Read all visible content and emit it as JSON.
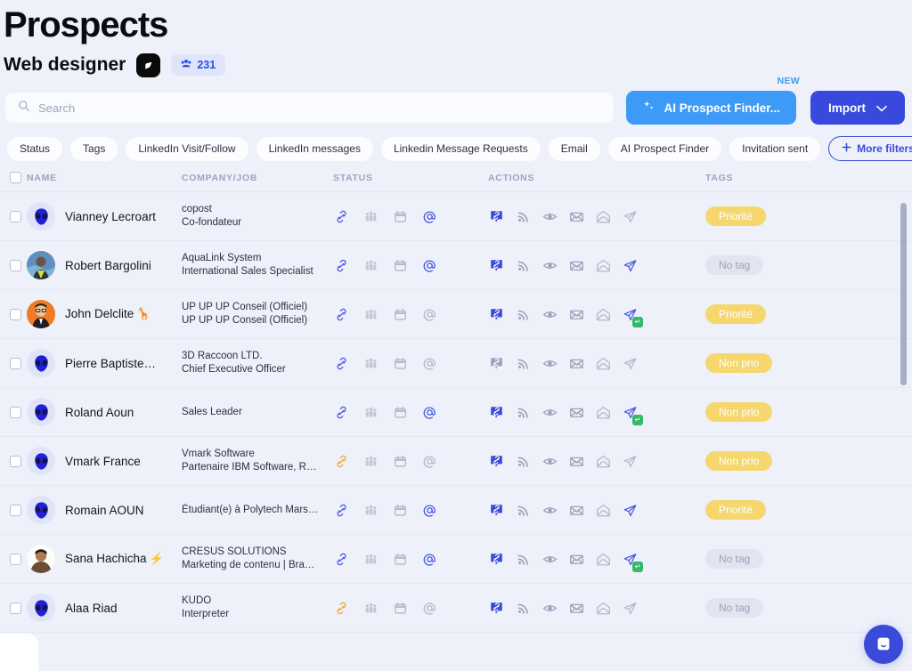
{
  "header": {
    "title": "Prospects",
    "subtitle": "Web designer",
    "list_icon": "linkedin-badge-icon",
    "count_icon": "people-icon",
    "count": "231"
  },
  "search": {
    "icon": "search-icon",
    "placeholder": "Search",
    "value": ""
  },
  "actions": {
    "ai_prospect_finder_label": "AI Prospect Finder...",
    "ai_prospect_finder_icon": "sparkle-icon",
    "ai_new_badge": "NEW",
    "import_label": "Import",
    "import_icon": "chevron-down-icon"
  },
  "filters": {
    "chips": [
      "Status",
      "Tags",
      "LinkedIn Visit/Follow",
      "LinkedIn messages",
      "Linkedin Message Requests",
      "Email",
      "AI Prospect Finder",
      "Invitation sent"
    ],
    "more_label": "More filters",
    "more_icon": "plus-icon"
  },
  "table": {
    "columns": [
      "NAME",
      "COMPANY/JOB",
      "STATUS",
      "ACTIONS",
      "TAGS"
    ],
    "status_icons": [
      "link-icon",
      "people-group-icon",
      "calendar-icon",
      "at-sign-icon"
    ],
    "action_icons": [
      "linkedin-link-badge-icon",
      "rss-icon",
      "eye-icon",
      "envelope-icon",
      "open-envelope-icon",
      "paper-plane-icon"
    ],
    "rows": [
      {
        "name": "Vianney Lecroart",
        "emoji": "",
        "avatar": "alien",
        "company": "copost",
        "job": "Co-fondateur",
        "status": [
          true,
          false,
          false,
          true
        ],
        "actions": {
          "link_badge": "blue",
          "send_active": false,
          "send_badge": false
        },
        "tag": "Priorité",
        "tag_kind": "prio"
      },
      {
        "name": "Robert Bargolini",
        "emoji": "",
        "avatar": "photo-blue",
        "company": "AquaLink System",
        "job": "International Sales Specialist",
        "status": [
          true,
          false,
          false,
          true
        ],
        "actions": {
          "link_badge": "blue",
          "send_active": true,
          "send_badge": false
        },
        "tag": "No tag",
        "tag_kind": "none"
      },
      {
        "name": "John Delclite",
        "emoji": "🦒",
        "avatar": "photo-orange",
        "company": "UP UP UP Conseil (Officiel)",
        "job": "UP UP UP Conseil (Officiel)",
        "status": [
          true,
          false,
          false,
          false
        ],
        "actions": {
          "link_badge": "blue",
          "send_active": true,
          "send_badge": true
        },
        "tag": "Priorité",
        "tag_kind": "prio"
      },
      {
        "name": "Pierre Baptiste…",
        "emoji": "",
        "avatar": "alien",
        "company": "3D Raccoon LTD.",
        "job": "Chief Executive Officer",
        "status": [
          true,
          false,
          false,
          false
        ],
        "actions": {
          "link_badge": "gray",
          "send_active": false,
          "send_badge": false
        },
        "tag": "Non prio",
        "tag_kind": "prio"
      },
      {
        "name": "Roland Aoun",
        "emoji": "",
        "avatar": "alien",
        "company": "",
        "job": "Sales Leader",
        "status": [
          true,
          false,
          false,
          true
        ],
        "actions": {
          "link_badge": "blue",
          "send_active": true,
          "send_badge": true
        },
        "tag": "Non prio",
        "tag_kind": "prio"
      },
      {
        "name": "Vmark France",
        "emoji": "",
        "avatar": "alien",
        "company": "Vmark Software",
        "job": "Partenaire IBM Software, R…",
        "status": [
          false,
          false,
          false,
          false
        ],
        "actions": {
          "link_badge": "blue",
          "send_active": false,
          "send_badge": false
        },
        "tag": "Non prio",
        "tag_kind": "prio"
      },
      {
        "name": "Romain AOUN",
        "emoji": "",
        "avatar": "alien",
        "company": "",
        "job": "Étudiant(e) à Polytech Mars…",
        "status": [
          true,
          false,
          false,
          true
        ],
        "actions": {
          "link_badge": "blue",
          "send_active": true,
          "send_badge": false
        },
        "tag": "Priorité",
        "tag_kind": "prio"
      },
      {
        "name": "Sana Hachicha",
        "emoji": "⚡",
        "avatar": "photo-dark",
        "company": "CRESUS SOLUTIONS",
        "job": "Marketing de contenu | Bra…",
        "status": [
          true,
          false,
          false,
          true
        ],
        "actions": {
          "link_badge": "blue",
          "send_active": true,
          "send_badge": true
        },
        "tag": "No tag",
        "tag_kind": "none"
      },
      {
        "name": "Alaa Riad",
        "emoji": "",
        "avatar": "alien",
        "company": "KUDO",
        "job": "Interpreter",
        "status": [
          false,
          false,
          false,
          false
        ],
        "actions": {
          "link_badge": "blue",
          "send_active": false,
          "send_badge": false
        },
        "tag": "No tag",
        "tag_kind": "none"
      }
    ]
  },
  "chat": {
    "icon": "chat-bubble-icon"
  },
  "colors": {
    "background": "#eef1fa",
    "accent_blue": "#3949dd",
    "ai_blue": "#3d9bf7",
    "tag_yellow": "#f5d76e",
    "tag_gray": "#e2e5f0",
    "send_badge_green": "#34b86a",
    "link_orange": "#f5a623",
    "link_blue": "#4a5ae0"
  }
}
